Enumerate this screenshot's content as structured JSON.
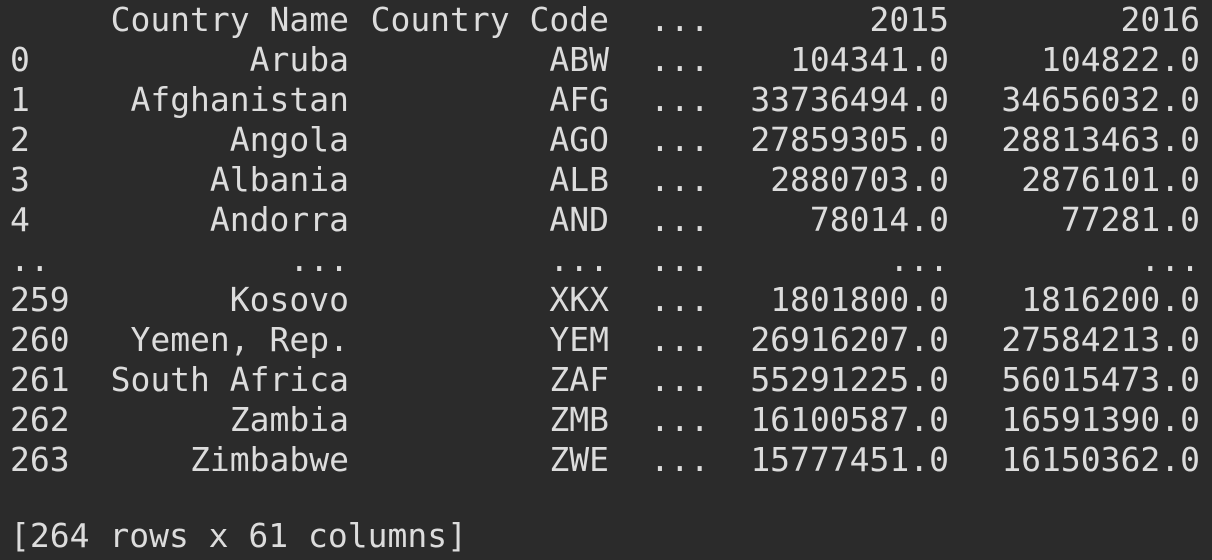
{
  "header": {
    "name": "Country Name",
    "code": "Country Code",
    "ellipsis": "...",
    "y2015": "2015",
    "y2016": "2016"
  },
  "rows": [
    {
      "idx": "0",
      "name": "Aruba",
      "code": "ABW",
      "ell": "...",
      "y2015": "104341.0",
      "y2016": "104822.0"
    },
    {
      "idx": "1",
      "name": "Afghanistan",
      "code": "AFG",
      "ell": "...",
      "y2015": "33736494.0",
      "y2016": "34656032.0"
    },
    {
      "idx": "2",
      "name": "Angola",
      "code": "AGO",
      "ell": "...",
      "y2015": "27859305.0",
      "y2016": "28813463.0"
    },
    {
      "idx": "3",
      "name": "Albania",
      "code": "ALB",
      "ell": "...",
      "y2015": "2880703.0",
      "y2016": "2876101.0"
    },
    {
      "idx": "4",
      "name": "Andorra",
      "code": "AND",
      "ell": "...",
      "y2015": "78014.0",
      "y2016": "77281.0"
    },
    {
      "idx": "..",
      "name": "...",
      "code": "...",
      "ell": "...",
      "y2015": "...",
      "y2016": "..."
    },
    {
      "idx": "259",
      "name": "Kosovo",
      "code": "XKX",
      "ell": "...",
      "y2015": "1801800.0",
      "y2016": "1816200.0"
    },
    {
      "idx": "260",
      "name": "Yemen, Rep.",
      "code": "YEM",
      "ell": "...",
      "y2015": "26916207.0",
      "y2016": "27584213.0"
    },
    {
      "idx": "261",
      "name": "South Africa",
      "code": "ZAF",
      "ell": "...",
      "y2015": "55291225.0",
      "y2016": "56015473.0"
    },
    {
      "idx": "262",
      "name": "Zambia",
      "code": "ZMB",
      "ell": "...",
      "y2015": "16100587.0",
      "y2016": "16591390.0"
    },
    {
      "idx": "263",
      "name": "Zimbabwe",
      "code": "ZWE",
      "ell": "...",
      "y2015": "15777451.0",
      "y2016": "16150362.0"
    }
  ],
  "footer": "[264 rows x 61 columns]",
  "colors": {
    "background": "#2b2b2b",
    "text": "#dcdcdc"
  }
}
